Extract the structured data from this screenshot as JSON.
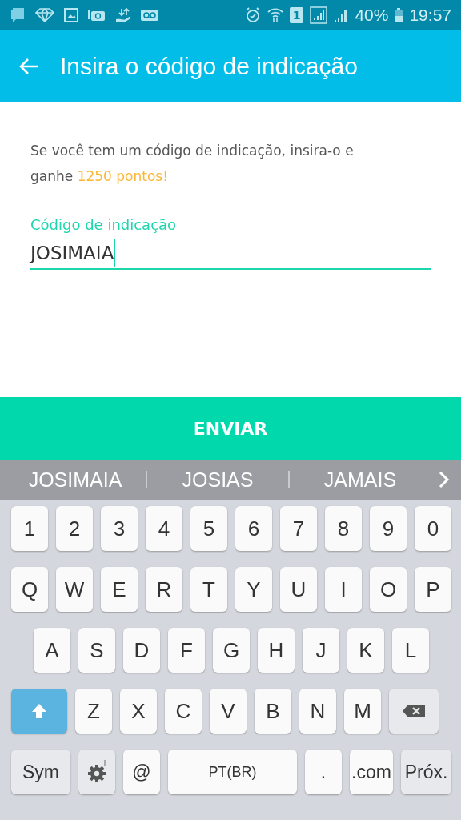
{
  "status_bar": {
    "sim": "1",
    "battery_text": "40%",
    "time": "19:57"
  },
  "app_bar": {
    "title": "Insira o código de indicação"
  },
  "intro": "Se você tem um código de indicação, insira-o e ganhe **1250 pontos!**",
  "field": {
    "label": "Código de indicação",
    "value": "JOSIMAIA"
  },
  "submit_button": "ENVIAR",
  "suggestions": [
    "JOSIMAIA",
    "JOSIAS",
    "JAMAIS"
  ],
  "keyboard": {
    "rows": [
      {
        "keys": [
          {
            "kind": "char",
            "label": "1"
          },
          {
            "kind": "char",
            "label": "2"
          },
          {
            "kind": "char",
            "label": "3"
          },
          {
            "kind": "char",
            "label": "4"
          },
          {
            "kind": "char",
            "label": "5"
          },
          {
            "kind": "char",
            "label": "6"
          },
          {
            "kind": "char",
            "label": "7"
          },
          {
            "kind": "char",
            "label": "8"
          },
          {
            "kind": "char",
            "label": "9"
          },
          {
            "kind": "char",
            "label": "0"
          }
        ]
      },
      {
        "keys": [
          {
            "kind": "char",
            "label": "Q"
          },
          {
            "kind": "char",
            "label": "W"
          },
          {
            "kind": "char",
            "label": "E"
          },
          {
            "kind": "char",
            "label": "R"
          },
          {
            "kind": "char",
            "label": "T"
          },
          {
            "kind": "char",
            "label": "Y"
          },
          {
            "kind": "char",
            "label": "U"
          },
          {
            "kind": "char",
            "label": "I"
          },
          {
            "kind": "char",
            "label": "O"
          },
          {
            "kind": "char",
            "label": "P"
          }
        ]
      },
      {
        "keys": [
          {
            "kind": "char",
            "label": "A"
          },
          {
            "kind": "char",
            "label": "S"
          },
          {
            "kind": "char",
            "label": "D"
          },
          {
            "kind": "char",
            "label": "F"
          },
          {
            "kind": "char",
            "label": "G"
          },
          {
            "kind": "char",
            "label": "H"
          },
          {
            "kind": "char",
            "label": "J"
          },
          {
            "kind": "char",
            "label": "K"
          },
          {
            "kind": "char",
            "label": "L"
          }
        ]
      },
      {
        "keys": [
          {
            "kind": "shift",
            "on": true
          },
          {
            "kind": "char",
            "label": "Z"
          },
          {
            "kind": "char",
            "label": "X"
          },
          {
            "kind": "char",
            "label": "C"
          },
          {
            "kind": "char",
            "label": "V"
          },
          {
            "kind": "char",
            "label": "B"
          },
          {
            "kind": "char",
            "label": "N"
          },
          {
            "kind": "char",
            "label": "M"
          },
          {
            "kind": "backspace"
          }
        ]
      },
      {
        "keys": [
          {
            "kind": "function",
            "label": "Sym"
          },
          {
            "kind": "settings"
          },
          {
            "kind": "char",
            "label": "@"
          },
          {
            "kind": "space",
            "label": "PT(BR)"
          },
          {
            "kind": "char",
            "label": "."
          },
          {
            "kind": "char",
            "label": ".com"
          },
          {
            "kind": "function",
            "label": "Próx."
          }
        ]
      }
    ]
  }
}
